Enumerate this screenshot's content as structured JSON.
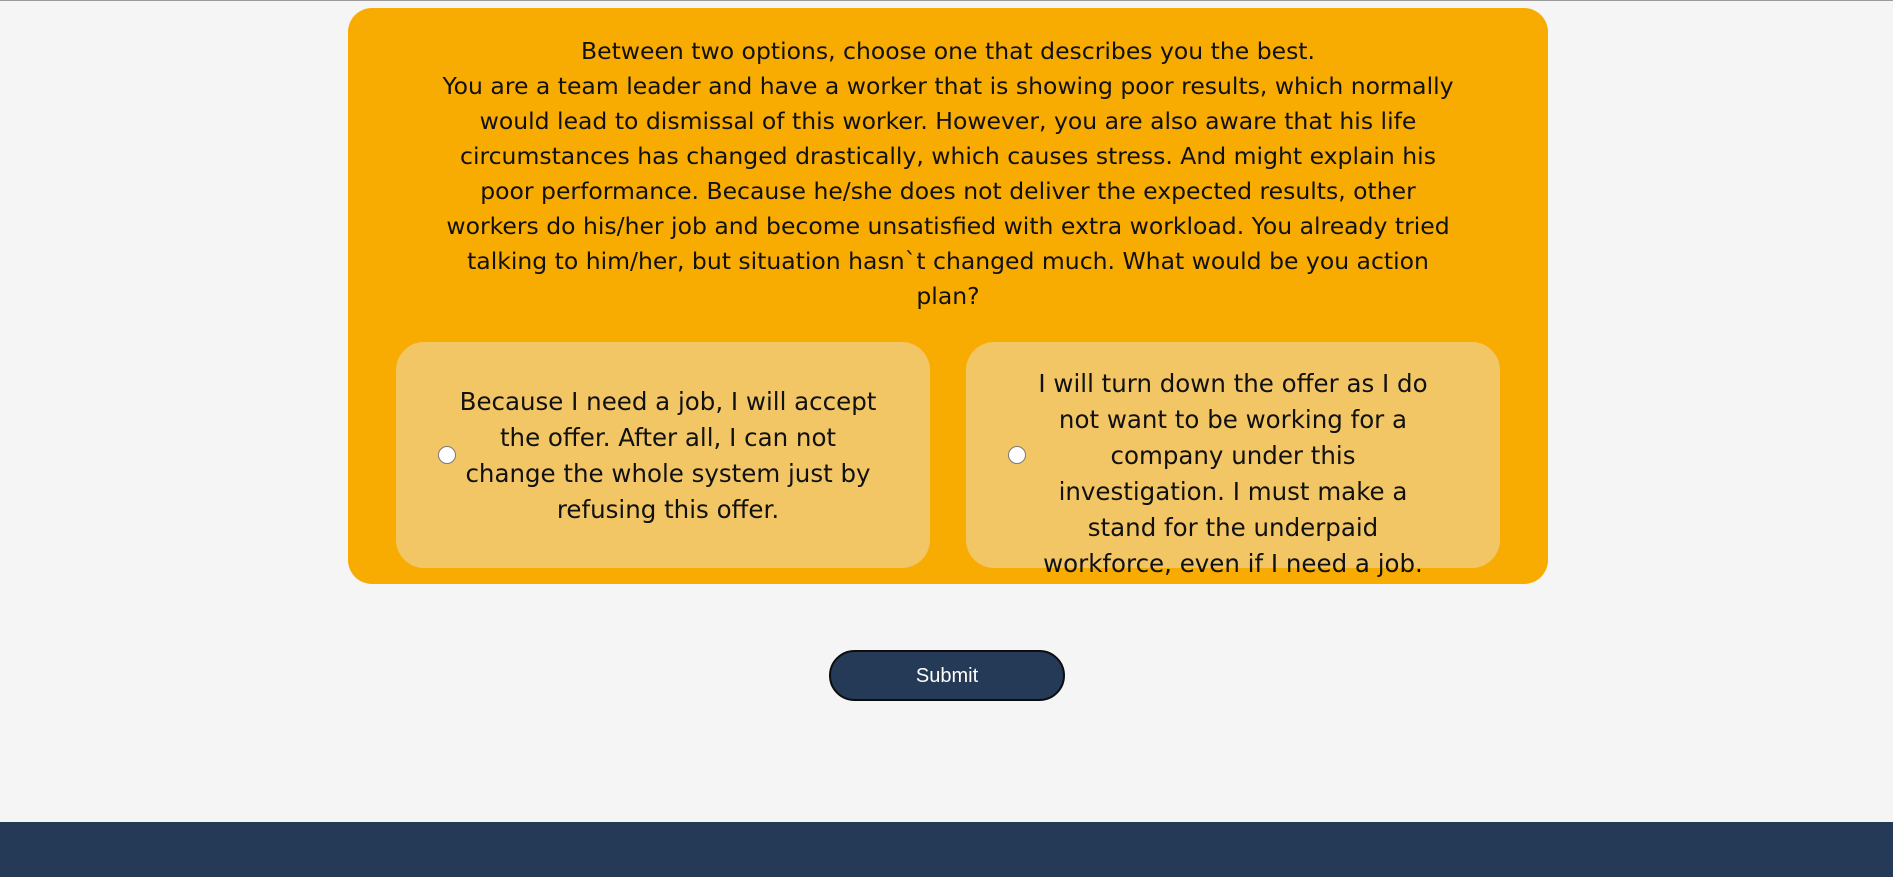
{
  "question": {
    "instruction": "Between two options, choose one that describes you the best.",
    "scenario": "You are a team leader and have a worker that is showing poor results, which normally would lead to dismissal of this worker. However, you are also aware that his life circumstances has changed drastically, which causes stress. And might explain his poor performance. Because he/she does not deliver the expected results, other workers do his/her job and become unsatisfied with extra workload. You already tried talking to him/her, but situation hasn`t changed much. What would be you action plan?"
  },
  "options": [
    {
      "text": "Because I need a job, I will accept the offer. After all, I can not change the whole system just by refusing this offer.",
      "selected": false
    },
    {
      "text": "I will turn down the offer as I do not want to be working for a company under this investigation. I must make a stand for the underpaid workforce, even if I need a job.",
      "selected": false
    }
  ],
  "submit_label": "Submit",
  "colors": {
    "page_background": "#f5f5f5",
    "card": "#f8ab00",
    "option": "#f2c565",
    "navy": "#243a56"
  }
}
